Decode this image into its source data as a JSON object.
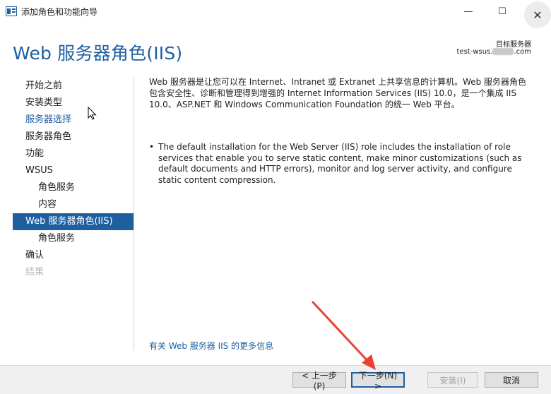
{
  "window": {
    "title": "添加角色和功能向导",
    "min_glyph": "—",
    "max_glyph": "☐",
    "close_glyph": "✕"
  },
  "page": {
    "heading": "Web 服务器角色(IIS)",
    "target_label": "目标服务器",
    "target_name_prefix": "test-wsus.",
    "target_name_suffix": ".com"
  },
  "nav": [
    {
      "label": "开始之前",
      "state": "normal"
    },
    {
      "label": "安装类型",
      "state": "normal"
    },
    {
      "label": "服务器选择",
      "state": "link"
    },
    {
      "label": "服务器角色",
      "state": "normal"
    },
    {
      "label": "功能",
      "state": "normal"
    },
    {
      "label": "WSUS",
      "state": "normal"
    },
    {
      "label": "角色服务",
      "state": "sub"
    },
    {
      "label": "内容",
      "state": "sub"
    },
    {
      "label": "Web 服务器角色(IIS)",
      "state": "selected"
    },
    {
      "label": "角色服务",
      "state": "sub"
    },
    {
      "label": "确认",
      "state": "normal"
    },
    {
      "label": "结果",
      "state": "disabled"
    }
  ],
  "content": {
    "description": "Web 服务器是让您可以在 Internet、Intranet 或 Extranet 上共享信息的计算机。Web 服务器角色包含安全性、诊断和管理得到增强的 Internet Information Services (IIS) 10.0，是一个集成 IIS 10.0、ASP.NET 和 Windows Communication Foundation 的统一 Web 平台。",
    "bullet_marker": "•",
    "bullet": "The default installation for the Web Server (IIS) role includes the installation of role services that enable you to serve static content, make minor customizations (such as default documents and HTTP errors), monitor and log server activity, and configure static content compression.",
    "more_info_link": "有关 Web 服务器 IIS 的更多信息"
  },
  "buttons": {
    "prev": "< 上一步(P)",
    "next": "下一步(N) >",
    "install": "安装(I)",
    "cancel": "取消"
  },
  "colors": {
    "accent": "#1f5fa0",
    "annotation_arrow": "#e8412f"
  }
}
